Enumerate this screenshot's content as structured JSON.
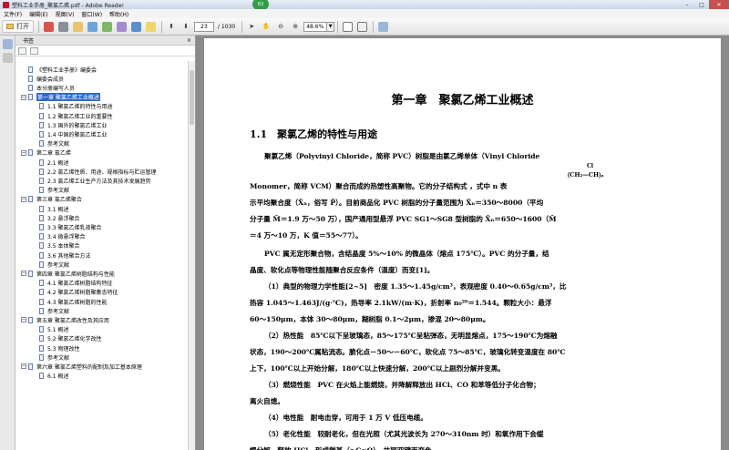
{
  "window": {
    "title": "塑料工业手册_聚氯乙烯.pdf - Adobe Reader",
    "badge": "63",
    "controls": {
      "minimize": "–",
      "maximize": "□",
      "close": "✕"
    }
  },
  "menubar": [
    "文件(F)",
    "编辑(E)",
    "视图(V)",
    "窗口(W)",
    "帮助(H)"
  ],
  "toolbar": {
    "open_label": "打开",
    "page_current": "23",
    "page_total": "/ 1030",
    "zoom": "48.6%"
  },
  "colors": {
    "selected": "#316ac5",
    "close_button": "#c75050"
  },
  "bookmarks_panel": {
    "title": "书签",
    "close": "×",
    "items": [
      {
        "level": 1,
        "toggle": "",
        "label": "《塑料工业手册》编委会",
        "selected": false
      },
      {
        "level": 1,
        "toggle": "",
        "label": "编委会成员",
        "selected": false
      },
      {
        "level": 1,
        "toggle": "",
        "label": "本分册编写人员",
        "selected": false
      },
      {
        "level": 0,
        "toggle": "−",
        "label": "第一章 聚氯乙烯工业概述",
        "selected": true
      },
      {
        "level": 2,
        "toggle": "",
        "label": "1.1 聚氯乙烯的特性与用途",
        "selected": false
      },
      {
        "level": 2,
        "toggle": "",
        "label": "1.2 聚氯乙烯工业的重要性",
        "selected": false
      },
      {
        "level": 2,
        "toggle": "",
        "label": "1.3 国外的聚氯乙烯工业",
        "selected": false
      },
      {
        "level": 2,
        "toggle": "",
        "label": "1.4 中国的聚氯乙烯工业",
        "selected": false
      },
      {
        "level": 2,
        "toggle": "",
        "label": "参考文献",
        "selected": false
      },
      {
        "level": 0,
        "toggle": "−",
        "label": "第二章 氯乙烯",
        "selected": false
      },
      {
        "level": 2,
        "toggle": "",
        "label": "2.1 概述",
        "selected": false
      },
      {
        "level": 2,
        "toggle": "",
        "label": "2.2 氯乙烯性质、用途、规格指标与贮运管理",
        "selected": false
      },
      {
        "level": 2,
        "toggle": "",
        "label": "2.3 氯乙烯工业生产方法及其技术发展趋势",
        "selected": false
      },
      {
        "level": 2,
        "toggle": "",
        "label": "参考文献",
        "selected": false
      },
      {
        "level": 0,
        "toggle": "−",
        "label": "第三章 氯乙烯聚合",
        "selected": false
      },
      {
        "level": 2,
        "toggle": "",
        "label": "3.1 概述",
        "selected": false
      },
      {
        "level": 2,
        "toggle": "",
        "label": "3.2 悬浮聚合",
        "selected": false
      },
      {
        "level": 2,
        "toggle": "",
        "label": "3.3 聚氯乙烯乳液聚合",
        "selected": false
      },
      {
        "level": 2,
        "toggle": "",
        "label": "3.4 微悬浮聚合",
        "selected": false
      },
      {
        "level": 2,
        "toggle": "",
        "label": "3.5 本体聚合",
        "selected": false
      },
      {
        "level": 2,
        "toggle": "",
        "label": "3.6 其他聚合方法",
        "selected": false
      },
      {
        "level": 2,
        "toggle": "",
        "label": "参考文献",
        "selected": false
      },
      {
        "level": 0,
        "toggle": "−",
        "label": "第四章 聚氯乙烯树脂结构与性能",
        "selected": false
      },
      {
        "level": 2,
        "toggle": "",
        "label": "4.1 聚氯乙烯树脂结构特征",
        "selected": false
      },
      {
        "level": 2,
        "toggle": "",
        "label": "4.2 聚氯乙烯树脂聚集态特征",
        "selected": false
      },
      {
        "level": 2,
        "toggle": "",
        "label": "4.3 聚氯乙烯树脂的性能",
        "selected": false
      },
      {
        "level": 2,
        "toggle": "",
        "label": "参考文献",
        "selected": false
      },
      {
        "level": 0,
        "toggle": "−",
        "label": "第五章 聚氯乙烯改性及其应用",
        "selected": false
      },
      {
        "level": 2,
        "toggle": "",
        "label": "5.1 概述",
        "selected": false
      },
      {
        "level": 2,
        "toggle": "",
        "label": "5.2 聚氯乙烯化学改性",
        "selected": false
      },
      {
        "level": 2,
        "toggle": "",
        "label": "5.3 物理改性",
        "selected": false
      },
      {
        "level": 2,
        "toggle": "",
        "label": "参考文献",
        "selected": false
      },
      {
        "level": 0,
        "toggle": "−",
        "label": "第六章 聚氯乙烯塑料的配制及加工基本原理",
        "selected": false
      },
      {
        "level": 2,
        "toggle": "",
        "label": "6.1 概述",
        "selected": false
      }
    ]
  },
  "document": {
    "chapter_title": "第一章　聚氯乙烯工业概述",
    "section_title": "1.1　聚氯乙烯的特性与用途",
    "formula_cl": "Cl",
    "formula_chain": "⟮CH₂—CH⟯ₙ",
    "lines": [
      "聚氯乙烯（Polyvinyl Chloride，简称 PVC）树脂是由氯乙烯单体（Vinyl Chloride",
      "Monomer，简称 VCM）聚合而成的热塑性高聚物。它的分子结构式                      ，式中 n 表",
      "示平均聚合度（X̄ₙ，俗写 P̄）。目前商品化 PVC 树脂的分子量范围为 X̄ₙ＝350～8000（平均",
      "分子量 M̄＝1.9 万～50 万），国产通用型悬浮 PVC SG1～SG8 型树脂的 X̄ₙ＝650～1600（M̄",
      "＝4 万～10 万，K 值＝55～77）。",
      "PVC 属无定形聚合物，含结晶度 5%～10% 的微晶体（熔点 175℃）。PVC 的分子量，结",
      "晶度、软化点等物理性能随聚合反应条件（温度）而变[1]。",
      "（1）典型的物理力学性能[2~5]　密度 1.35～1.45g/cm³，表观密度 0.40～0.65g/cm³，比",
      "热容 1.045～1.463J/(g·℃)，热导率 2.1kW/(m·K)，折射率 n₀²⁰＝1.544。颗粒大小：悬浮",
      "60～150μm，本体 30～80μm，糊树脂 0.1～2μm，掺混 20～80μm。",
      "（2）热性能　85℃以下呈玻璃态，85～175℃呈粘弹态，无明显熔点，175～190℃为熔融",
      "状态，190～200℃属粘流态。脆化点－50～－60℃，软化点 75～85℃，玻璃化转变温度在 80℃",
      "上下，100℃以上开始分解，180℃以上快速分解，200℃以上剧烈分解并变黑。",
      "（3）燃烧性能　PVC 在火焰上能燃烧，并降解释放出 HCl、CO 和苯等低分子化合物；",
      "离火自熄。",
      "（4）电性能　耐电击穿，可用于 1 万 V 低压电缆。",
      "（5）老化性能　较耐老化，但在光照（尤其光波长为 270～310nm 时）和氧作用下会缓",
      "慢分解，释放 HCl，形成羰基（>C=O）、共轭双键而变色。"
    ]
  }
}
